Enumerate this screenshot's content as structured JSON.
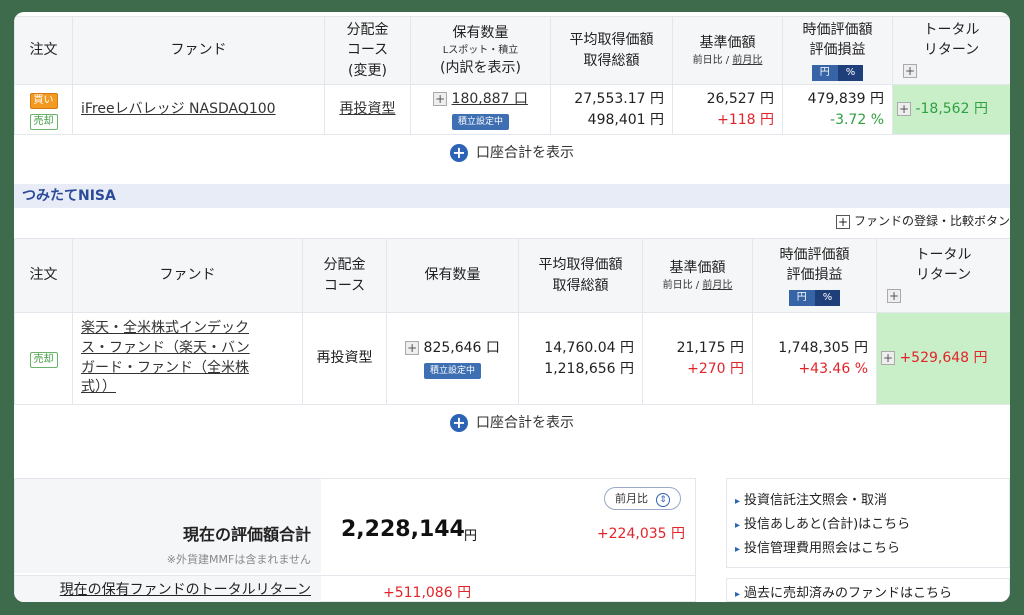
{
  "top_table": {
    "headers": {
      "order": "注文",
      "fund": "ファンド",
      "course_l1": "分配金",
      "course_l2": "コース",
      "course_l3": "(変更)",
      "qty_l1": "保有数量",
      "qty_sub": "Lスポット・積立",
      "qty_l3": "(内訳を表示)",
      "avg_l1": "平均取得価額",
      "avg_l2": "取得総額",
      "base_l1": "基準価額",
      "base_sub_a": "前日比 / ",
      "base_sub_b": "前月比",
      "mv_l1": "時価評価額",
      "mv_l2": "評価損益",
      "toggle_yen": "円",
      "toggle_pct": "%",
      "total_l1": "トータル",
      "total_l2": "リターン"
    },
    "row": {
      "badge_buy": "買い",
      "badge_sell": "売却",
      "fund": "iFreeレバレッジ NASDAQ100",
      "course": "再投資型",
      "qty": "180,887 口",
      "reserve": "積立設定中",
      "avg_price": "27,553.17 円",
      "avg_total": "498,401 円",
      "base_price": "26,527 円",
      "base_diff": "+118 円",
      "market_value": "479,839 円",
      "pl_pct": "-3.72 %",
      "total_return": "-18,562 円"
    },
    "show_total": "口座合計を表示"
  },
  "nisa": {
    "section_title": "つみたてNISA",
    "compare_button": "ファンドの登録・比較ボタン",
    "headers": {
      "order": "注文",
      "fund": "ファンド",
      "course_l1": "分配金",
      "course_l2": "コース",
      "qty": "保有数量",
      "avg_l1": "平均取得価額",
      "avg_l2": "取得総額",
      "base_l1": "基準価額",
      "base_sub_a": "前日比 / ",
      "base_sub_b": "前月比",
      "mv_l1": "時価評価額",
      "mv_l2": "評価損益",
      "toggle_yen": "円",
      "toggle_pct": "%",
      "total_l1": "トータル",
      "total_l2": "リターン"
    },
    "row": {
      "badge_sell": "売却",
      "fund_l1": "楽天・全米株式インデック",
      "fund_l2": "ス・ファンド（楽天・バン",
      "fund_l3": "ガード・ファンド（全米株",
      "fund_l4": "式））",
      "course": "再投資型",
      "qty": "825,646 口",
      "reserve": "積立設定中",
      "avg_price": "14,760.04 円",
      "avg_total": "1,218,656 円",
      "base_price": "21,175 円",
      "base_diff": "+270 円",
      "market_value": "1,748,305 円",
      "pl_pct": "+43.46 %",
      "total_return": "+529,648 円"
    },
    "show_total": "口座合計を表示"
  },
  "summary": {
    "select_label": "前月比",
    "label": "現在の評価額合計",
    "note": "※外貨建MMFは含まれません",
    "value": "2,228,144",
    "yen": "円",
    "diff": "+224,035 円",
    "total_return_label": "現在の保有ファンドのトータルリターン",
    "total_return_value": "+511,086 円"
  },
  "links": [
    "投資信託注文照会・取消",
    "投信あしあと(合計)はこちら",
    "投信管理費用照会はこちら"
  ],
  "link_sold": "過去に売却済みのファンドはこちら",
  "colors": {
    "frame_bg": "#3f6b4d",
    "positive": "#e2242a",
    "negative": "#30a040",
    "total_bg": "#c8efc8",
    "accent_blue": "#2c63b5"
  }
}
